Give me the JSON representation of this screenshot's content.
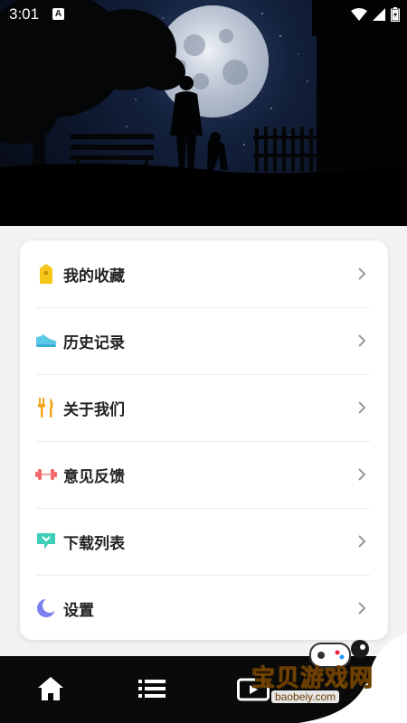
{
  "status_bar": {
    "time": "3:01",
    "badge": "A",
    "icons": [
      "wifi-icon",
      "signal-icon",
      "battery-icon"
    ]
  },
  "hero": {
    "image": "night-sky-moon-silhouette"
  },
  "menu": {
    "items": [
      {
        "label": "我的收藏",
        "icon": "bookmark-icon",
        "color": "#f5c518"
      },
      {
        "label": "历史记录",
        "icon": "sneaker-icon",
        "color": "#5bc8e8"
      },
      {
        "label": "关于我们",
        "icon": "utensils-icon",
        "color": "#f2a51a"
      },
      {
        "label": "意见反馈",
        "icon": "dumbbell-icon",
        "color": "#f26b6b"
      },
      {
        "label": "下载列表",
        "icon": "download-tag-icon",
        "color": "#3fcfb6"
      },
      {
        "label": "设置",
        "icon": "moon-icon",
        "color": "#7b7ff0"
      }
    ]
  },
  "bottom_nav": {
    "items": [
      {
        "icon": "home-icon"
      },
      {
        "icon": "list-icon"
      },
      {
        "icon": "video-icon"
      }
    ]
  },
  "watermark": {
    "text": "宝贝游戏网",
    "url": "baobeiy.com"
  }
}
